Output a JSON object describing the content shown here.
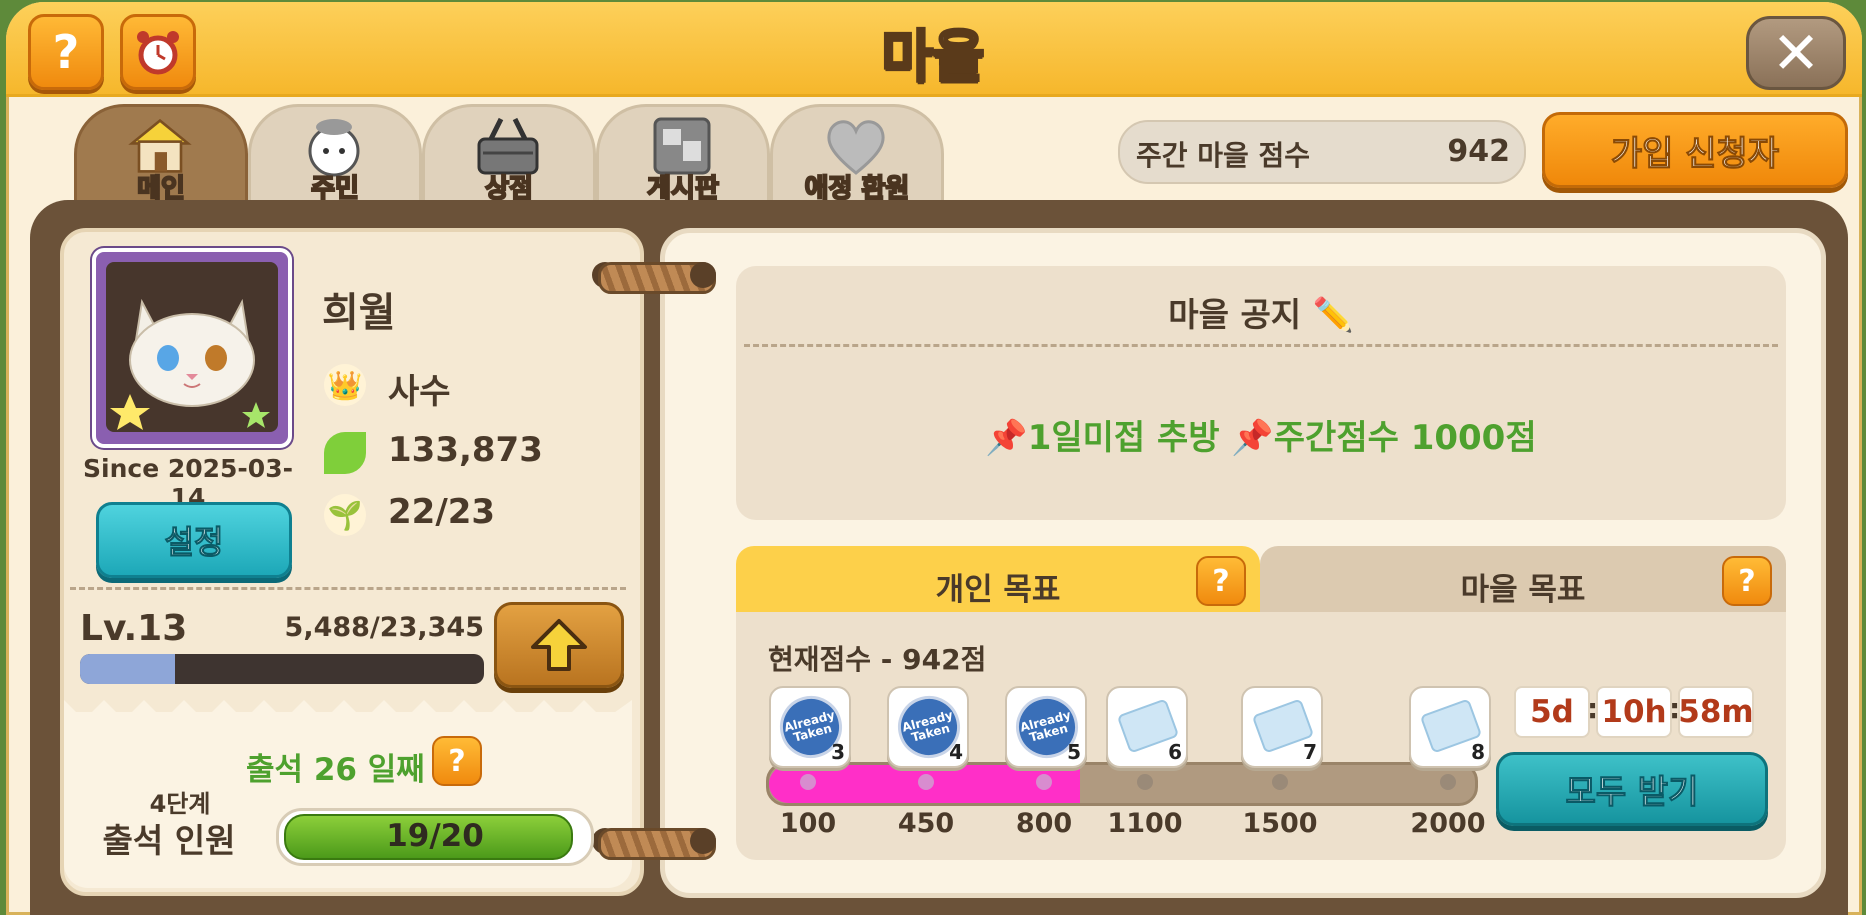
{
  "header": {
    "title": "마을",
    "help_label": "?",
    "close_label": "✕"
  },
  "tabs": [
    {
      "label": "메인",
      "active": true
    },
    {
      "label": "주민",
      "active": false
    },
    {
      "label": "상점",
      "active": false
    },
    {
      "label": "게시판",
      "active": false
    },
    {
      "label": "애정 환원",
      "active": false
    }
  ],
  "weekly_score": {
    "label": "주간 마을 점수",
    "value": "942"
  },
  "applicants_button": "가입 신청자",
  "profile": {
    "name": "희월",
    "role": "사수",
    "leaves": "133,873",
    "members": "22/23",
    "since": "Since 2025-03-14",
    "settings_label": "설정"
  },
  "level": {
    "label": "Lv.13",
    "exp_text": "5,488/23,345",
    "exp_fraction": 0.235
  },
  "attendance": {
    "days_text": "출석 26 일째",
    "stage_text": "4단계",
    "members_label": "출석 인원",
    "members_text": "19/20",
    "fraction": 0.95
  },
  "notice": {
    "title": "마을 공지",
    "text": "📌1일미접 추방 📌주간점수 1000점"
  },
  "goals": {
    "personal_tab": "개인 목표",
    "village_tab": "마을 목표",
    "current_score_text": "현재점수 - 942점",
    "current_score": 942,
    "milestones": [
      {
        "score": "100",
        "reward_count": "3",
        "taken": true,
        "taken_text": "Already Taken"
      },
      {
        "score": "450",
        "reward_count": "4",
        "taken": true,
        "taken_text": "Already Taken"
      },
      {
        "score": "800",
        "reward_count": "5",
        "taken": true,
        "taken_text": "Already Taken"
      },
      {
        "score": "1100",
        "reward_count": "6",
        "taken": false
      },
      {
        "score": "1500",
        "reward_count": "7",
        "taken": false
      },
      {
        "score": "2000",
        "reward_count": "8",
        "taken": false
      }
    ],
    "progress_fraction": 0.44,
    "timer": {
      "days": "5d",
      "hours": "10h",
      "minutes": "58m",
      "sep": ":"
    },
    "claim_all_label": "모두 받기"
  },
  "colors": {
    "accent_orange": "#f08a0e",
    "teal": "#1da8b8",
    "green_text": "#4ea12e",
    "progress_pink": "#ff2fc8"
  }
}
